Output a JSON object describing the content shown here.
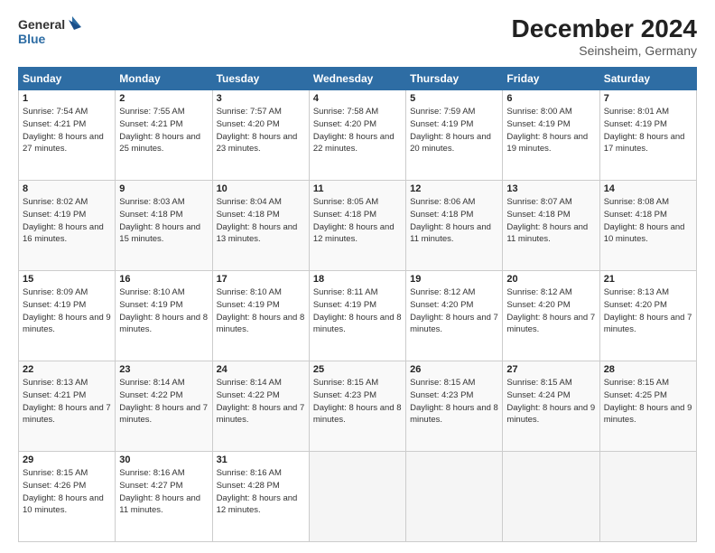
{
  "header": {
    "logo_line1": "General",
    "logo_line2": "Blue",
    "month": "December 2024",
    "location": "Seinsheim, Germany"
  },
  "days_of_week": [
    "Sunday",
    "Monday",
    "Tuesday",
    "Wednesday",
    "Thursday",
    "Friday",
    "Saturday"
  ],
  "weeks": [
    [
      {
        "day": 1,
        "sunrise": "7:54 AM",
        "sunset": "4:21 PM",
        "daylight": "8 hours and 27 minutes."
      },
      {
        "day": 2,
        "sunrise": "7:55 AM",
        "sunset": "4:21 PM",
        "daylight": "8 hours and 25 minutes."
      },
      {
        "day": 3,
        "sunrise": "7:57 AM",
        "sunset": "4:20 PM",
        "daylight": "8 hours and 23 minutes."
      },
      {
        "day": 4,
        "sunrise": "7:58 AM",
        "sunset": "4:20 PM",
        "daylight": "8 hours and 22 minutes."
      },
      {
        "day": 5,
        "sunrise": "7:59 AM",
        "sunset": "4:19 PM",
        "daylight": "8 hours and 20 minutes."
      },
      {
        "day": 6,
        "sunrise": "8:00 AM",
        "sunset": "4:19 PM",
        "daylight": "8 hours and 19 minutes."
      },
      {
        "day": 7,
        "sunrise": "8:01 AM",
        "sunset": "4:19 PM",
        "daylight": "8 hours and 17 minutes."
      }
    ],
    [
      {
        "day": 8,
        "sunrise": "8:02 AM",
        "sunset": "4:19 PM",
        "daylight": "8 hours and 16 minutes."
      },
      {
        "day": 9,
        "sunrise": "8:03 AM",
        "sunset": "4:18 PM",
        "daylight": "8 hours and 15 minutes."
      },
      {
        "day": 10,
        "sunrise": "8:04 AM",
        "sunset": "4:18 PM",
        "daylight": "8 hours and 13 minutes."
      },
      {
        "day": 11,
        "sunrise": "8:05 AM",
        "sunset": "4:18 PM",
        "daylight": "8 hours and 12 minutes."
      },
      {
        "day": 12,
        "sunrise": "8:06 AM",
        "sunset": "4:18 PM",
        "daylight": "8 hours and 11 minutes."
      },
      {
        "day": 13,
        "sunrise": "8:07 AM",
        "sunset": "4:18 PM",
        "daylight": "8 hours and 11 minutes."
      },
      {
        "day": 14,
        "sunrise": "8:08 AM",
        "sunset": "4:18 PM",
        "daylight": "8 hours and 10 minutes."
      }
    ],
    [
      {
        "day": 15,
        "sunrise": "8:09 AM",
        "sunset": "4:19 PM",
        "daylight": "8 hours and 9 minutes."
      },
      {
        "day": 16,
        "sunrise": "8:10 AM",
        "sunset": "4:19 PM",
        "daylight": "8 hours and 8 minutes."
      },
      {
        "day": 17,
        "sunrise": "8:10 AM",
        "sunset": "4:19 PM",
        "daylight": "8 hours and 8 minutes."
      },
      {
        "day": 18,
        "sunrise": "8:11 AM",
        "sunset": "4:19 PM",
        "daylight": "8 hours and 8 minutes."
      },
      {
        "day": 19,
        "sunrise": "8:12 AM",
        "sunset": "4:20 PM",
        "daylight": "8 hours and 7 minutes."
      },
      {
        "day": 20,
        "sunrise": "8:12 AM",
        "sunset": "4:20 PM",
        "daylight": "8 hours and 7 minutes."
      },
      {
        "day": 21,
        "sunrise": "8:13 AM",
        "sunset": "4:20 PM",
        "daylight": "8 hours and 7 minutes."
      }
    ],
    [
      {
        "day": 22,
        "sunrise": "8:13 AM",
        "sunset": "4:21 PM",
        "daylight": "8 hours and 7 minutes."
      },
      {
        "day": 23,
        "sunrise": "8:14 AM",
        "sunset": "4:22 PM",
        "daylight": "8 hours and 7 minutes."
      },
      {
        "day": 24,
        "sunrise": "8:14 AM",
        "sunset": "4:22 PM",
        "daylight": "8 hours and 7 minutes."
      },
      {
        "day": 25,
        "sunrise": "8:15 AM",
        "sunset": "4:23 PM",
        "daylight": "8 hours and 8 minutes."
      },
      {
        "day": 26,
        "sunrise": "8:15 AM",
        "sunset": "4:23 PM",
        "daylight": "8 hours and 8 minutes."
      },
      {
        "day": 27,
        "sunrise": "8:15 AM",
        "sunset": "4:24 PM",
        "daylight": "8 hours and 9 minutes."
      },
      {
        "day": 28,
        "sunrise": "8:15 AM",
        "sunset": "4:25 PM",
        "daylight": "8 hours and 9 minutes."
      }
    ],
    [
      {
        "day": 29,
        "sunrise": "8:15 AM",
        "sunset": "4:26 PM",
        "daylight": "8 hours and 10 minutes."
      },
      {
        "day": 30,
        "sunrise": "8:16 AM",
        "sunset": "4:27 PM",
        "daylight": "8 hours and 11 minutes."
      },
      {
        "day": 31,
        "sunrise": "8:16 AM",
        "sunset": "4:28 PM",
        "daylight": "8 hours and 12 minutes."
      },
      null,
      null,
      null,
      null
    ]
  ]
}
